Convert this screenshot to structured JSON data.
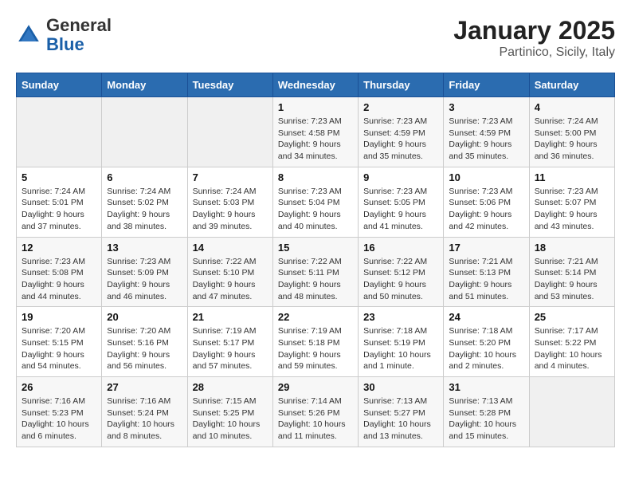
{
  "header": {
    "logo_general": "General",
    "logo_blue": "Blue",
    "month_title": "January 2025",
    "location": "Partinico, Sicily, Italy"
  },
  "weekdays": [
    "Sunday",
    "Monday",
    "Tuesday",
    "Wednesday",
    "Thursday",
    "Friday",
    "Saturday"
  ],
  "weeks": [
    [
      {
        "day": "",
        "info": ""
      },
      {
        "day": "",
        "info": ""
      },
      {
        "day": "",
        "info": ""
      },
      {
        "day": "1",
        "info": "Sunrise: 7:23 AM\nSunset: 4:58 PM\nDaylight: 9 hours\nand 34 minutes."
      },
      {
        "day": "2",
        "info": "Sunrise: 7:23 AM\nSunset: 4:59 PM\nDaylight: 9 hours\nand 35 minutes."
      },
      {
        "day": "3",
        "info": "Sunrise: 7:23 AM\nSunset: 4:59 PM\nDaylight: 9 hours\nand 35 minutes."
      },
      {
        "day": "4",
        "info": "Sunrise: 7:24 AM\nSunset: 5:00 PM\nDaylight: 9 hours\nand 36 minutes."
      }
    ],
    [
      {
        "day": "5",
        "info": "Sunrise: 7:24 AM\nSunset: 5:01 PM\nDaylight: 9 hours\nand 37 minutes."
      },
      {
        "day": "6",
        "info": "Sunrise: 7:24 AM\nSunset: 5:02 PM\nDaylight: 9 hours\nand 38 minutes."
      },
      {
        "day": "7",
        "info": "Sunrise: 7:24 AM\nSunset: 5:03 PM\nDaylight: 9 hours\nand 39 minutes."
      },
      {
        "day": "8",
        "info": "Sunrise: 7:23 AM\nSunset: 5:04 PM\nDaylight: 9 hours\nand 40 minutes."
      },
      {
        "day": "9",
        "info": "Sunrise: 7:23 AM\nSunset: 5:05 PM\nDaylight: 9 hours\nand 41 minutes."
      },
      {
        "day": "10",
        "info": "Sunrise: 7:23 AM\nSunset: 5:06 PM\nDaylight: 9 hours\nand 42 minutes."
      },
      {
        "day": "11",
        "info": "Sunrise: 7:23 AM\nSunset: 5:07 PM\nDaylight: 9 hours\nand 43 minutes."
      }
    ],
    [
      {
        "day": "12",
        "info": "Sunrise: 7:23 AM\nSunset: 5:08 PM\nDaylight: 9 hours\nand 44 minutes."
      },
      {
        "day": "13",
        "info": "Sunrise: 7:23 AM\nSunset: 5:09 PM\nDaylight: 9 hours\nand 46 minutes."
      },
      {
        "day": "14",
        "info": "Sunrise: 7:22 AM\nSunset: 5:10 PM\nDaylight: 9 hours\nand 47 minutes."
      },
      {
        "day": "15",
        "info": "Sunrise: 7:22 AM\nSunset: 5:11 PM\nDaylight: 9 hours\nand 48 minutes."
      },
      {
        "day": "16",
        "info": "Sunrise: 7:22 AM\nSunset: 5:12 PM\nDaylight: 9 hours\nand 50 minutes."
      },
      {
        "day": "17",
        "info": "Sunrise: 7:21 AM\nSunset: 5:13 PM\nDaylight: 9 hours\nand 51 minutes."
      },
      {
        "day": "18",
        "info": "Sunrise: 7:21 AM\nSunset: 5:14 PM\nDaylight: 9 hours\nand 53 minutes."
      }
    ],
    [
      {
        "day": "19",
        "info": "Sunrise: 7:20 AM\nSunset: 5:15 PM\nDaylight: 9 hours\nand 54 minutes."
      },
      {
        "day": "20",
        "info": "Sunrise: 7:20 AM\nSunset: 5:16 PM\nDaylight: 9 hours\nand 56 minutes."
      },
      {
        "day": "21",
        "info": "Sunrise: 7:19 AM\nSunset: 5:17 PM\nDaylight: 9 hours\nand 57 minutes."
      },
      {
        "day": "22",
        "info": "Sunrise: 7:19 AM\nSunset: 5:18 PM\nDaylight: 9 hours\nand 59 minutes."
      },
      {
        "day": "23",
        "info": "Sunrise: 7:18 AM\nSunset: 5:19 PM\nDaylight: 10 hours\nand 1 minute."
      },
      {
        "day": "24",
        "info": "Sunrise: 7:18 AM\nSunset: 5:20 PM\nDaylight: 10 hours\nand 2 minutes."
      },
      {
        "day": "25",
        "info": "Sunrise: 7:17 AM\nSunset: 5:22 PM\nDaylight: 10 hours\nand 4 minutes."
      }
    ],
    [
      {
        "day": "26",
        "info": "Sunrise: 7:16 AM\nSunset: 5:23 PM\nDaylight: 10 hours\nand 6 minutes."
      },
      {
        "day": "27",
        "info": "Sunrise: 7:16 AM\nSunset: 5:24 PM\nDaylight: 10 hours\nand 8 minutes."
      },
      {
        "day": "28",
        "info": "Sunrise: 7:15 AM\nSunset: 5:25 PM\nDaylight: 10 hours\nand 10 minutes."
      },
      {
        "day": "29",
        "info": "Sunrise: 7:14 AM\nSunset: 5:26 PM\nDaylight: 10 hours\nand 11 minutes."
      },
      {
        "day": "30",
        "info": "Sunrise: 7:13 AM\nSunset: 5:27 PM\nDaylight: 10 hours\nand 13 minutes."
      },
      {
        "day": "31",
        "info": "Sunrise: 7:13 AM\nSunset: 5:28 PM\nDaylight: 10 hours\nand 15 minutes."
      },
      {
        "day": "",
        "info": ""
      }
    ]
  ]
}
